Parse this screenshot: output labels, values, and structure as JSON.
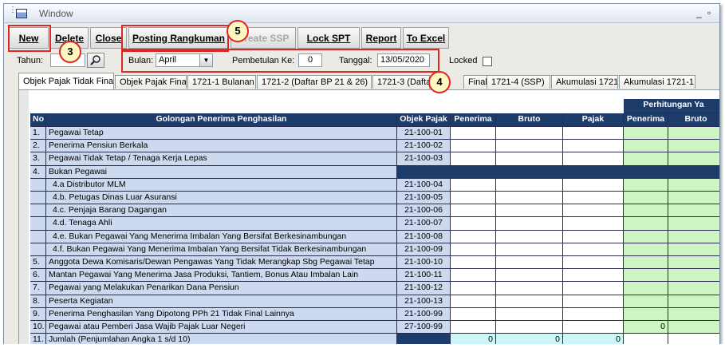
{
  "window": {
    "title": "Window"
  },
  "toolbar": {
    "new": "New",
    "delete": "Delete",
    "close": "Close",
    "posting": "Posting Rangkuman",
    "create_ssp": "Create SSP",
    "lock_spt": "Lock SPT",
    "report": "Report",
    "to_excel": "To Excel"
  },
  "filters": {
    "tahun_label": "Tahun:",
    "bulan_label": "Bulan:",
    "bulan_value": "April",
    "pembetulan_label": "Pembetulan Ke:",
    "pembetulan_value": "0",
    "tanggal_label": "Tanggal:",
    "tanggal_value": "13/05/2020",
    "locked_label": "Locked"
  },
  "tabs": [
    "Objek Pajak Tidak Final",
    "Objek Pajak Final",
    "1721-1 Bulanan",
    "1721-2 (Daftar BP 21 & 26)",
    "1721-3 (Daftar",
    "Final)",
    "1721-4 (SSP)",
    "Akumulasi 1721",
    "Akumulasi 1721-1"
  ],
  "callouts": [
    "3",
    "4",
    "5"
  ],
  "table": {
    "group_header": "Perhitungan Ya",
    "headers": [
      "No",
      "Golongan Penerima Penghasilan",
      "Objek Pajak",
      "Penerima",
      "Bruto",
      "Pajak",
      "Penerima",
      "Bruto"
    ],
    "rows": [
      {
        "no": "1.",
        "name": "Pegawai Tetap",
        "code": "21-100-01",
        "type": "main"
      },
      {
        "no": "2.",
        "name": "Penerima Pensiun Berkala",
        "code": "21-100-02",
        "type": "main"
      },
      {
        "no": "3.",
        "name": "Pegawai Tidak Tetap / Tenaga Kerja Lepas",
        "code": "21-100-03",
        "type": "main"
      },
      {
        "no": "4.",
        "name": "Bukan Pegawai",
        "code": "",
        "type": "group"
      },
      {
        "no": "",
        "name": "4.a Distributor MLM",
        "code": "21-100-04",
        "type": "sub"
      },
      {
        "no": "",
        "name": "4.b. Petugas Dinas Luar Asuransi",
        "code": "21-100-05",
        "type": "sub"
      },
      {
        "no": "",
        "name": "4.c. Penjaja Barang Dagangan",
        "code": "21-100-06",
        "type": "sub"
      },
      {
        "no": "",
        "name": "4.d. Tenaga Ahli",
        "code": "21-100-07",
        "type": "sub"
      },
      {
        "no": "",
        "name": "4.e. Bukan Pegawai Yang Menerima Imbalan Yang Bersifat Berkesinambungan",
        "code": "21-100-08",
        "type": "sub"
      },
      {
        "no": "",
        "name": "4.f. Bukan Pegawai Yang Menerima Imbalan Yang Bersifat Tidak Berkesinambungan",
        "code": "21-100-09",
        "type": "sub"
      },
      {
        "no": "5.",
        "name": "Anggota Dewa Komisaris/Dewan Pengawas Yang Tidak Merangkap Sbg Pegawai Tetap",
        "code": "21-100-10",
        "type": "main"
      },
      {
        "no": "6.",
        "name": "Mantan Pegawai Yang Menerima Jasa Produksi, Tantiem, Bonus Atau Imbalan Lain",
        "code": "21-100-11",
        "type": "main"
      },
      {
        "no": "7.",
        "name": "Pegawai yang Melakukan Penarikan Dana Pensiun",
        "code": "21-100-12",
        "type": "main"
      },
      {
        "no": "8.",
        "name": "Peserta Kegiatan",
        "code": "21-100-13",
        "type": "main"
      },
      {
        "no": "9.",
        "name": "Penerima Penghasilan Yang Dipotong PPh 21 Tidak Final Lainnya",
        "code": "21-100-99",
        "type": "main"
      },
      {
        "no": "10.",
        "name": "Pegawai atau Pemberi Jasa Wajib Pajak Luar Negeri",
        "code": "27-100-99",
        "type": "main"
      },
      {
        "no": "11.",
        "name": "Jumlah (Penjumlahan Angka 1 s/d 10)",
        "code": "",
        "type": "total"
      }
    ],
    "row10_penerima2": "0",
    "totals": {
      "penerima": "0",
      "bruto": "0",
      "pajak": "0"
    }
  }
}
